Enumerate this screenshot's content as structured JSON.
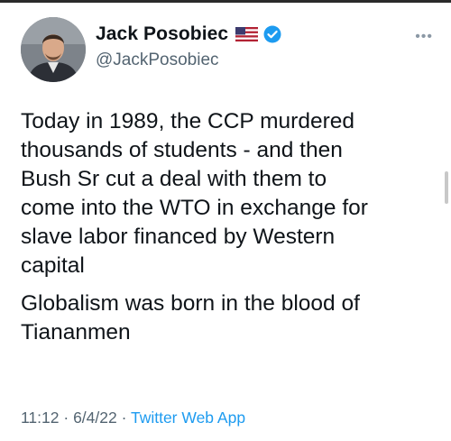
{
  "user": {
    "display_name": "Jack Posobiec",
    "handle": "@JackPosobiec",
    "badges": [
      "us-flag-icon",
      "verified-icon"
    ],
    "verified_color": "#1d9bf0"
  },
  "tweet": {
    "paragraphs": [
      "Today in 1989, the CCP murdered\nthousands of students - and then\nBush Sr cut a deal with them to\ncome into the WTO in exchange for\nslave labor financed by Western\ncapital",
      "Globalism was born in the blood of\nTiananmen"
    ]
  },
  "meta": {
    "time": "11:12",
    "separator": " · ",
    "date": "6/4/22",
    "app": "Twitter Web App"
  },
  "colors": {
    "text": "#0f1419",
    "secondary": "#536471",
    "link": "#1d9bf0"
  }
}
